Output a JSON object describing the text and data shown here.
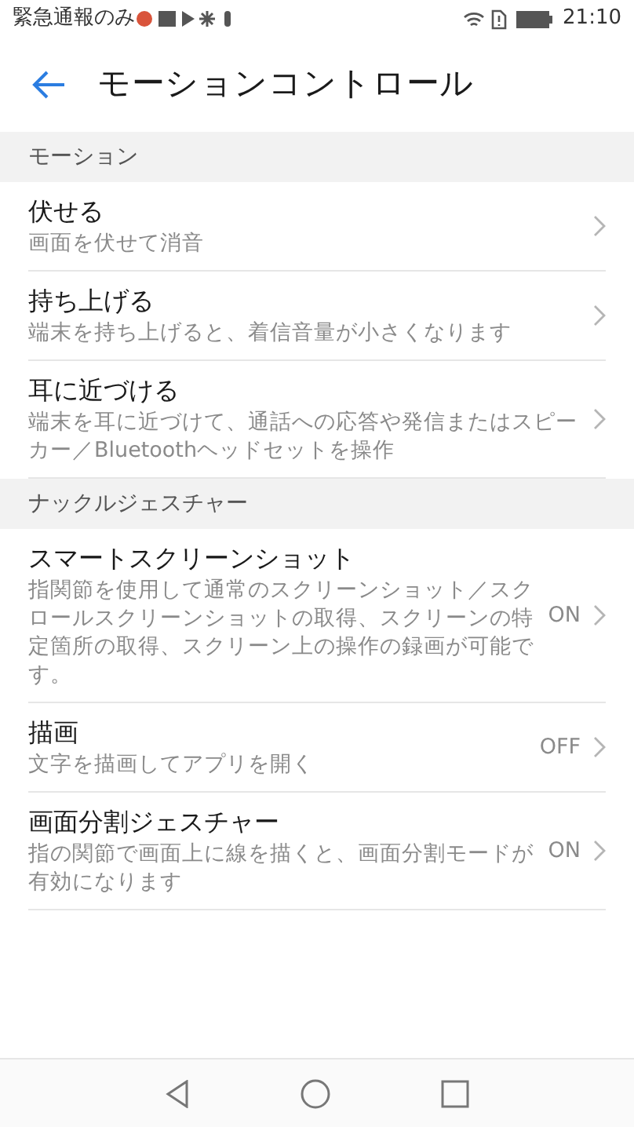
{
  "status_bar": {
    "carrier": "緊急通報のみ",
    "time": "21:10"
  },
  "header": {
    "title": "モーションコントロール"
  },
  "sections": [
    {
      "title": "モーション",
      "items": [
        {
          "title": "伏せる",
          "description": "画面を伏せて消音"
        },
        {
          "title": "持ち上げる",
          "description": "端末を持ち上げると、着信音量が小さくなります"
        },
        {
          "title": "耳に近づける",
          "description": "端末を耳に近づけて、通話への応答や発信またはスピーカー／Bluetoothヘッドセットを操作"
        }
      ]
    },
    {
      "title": "ナックルジェスチャー",
      "items": [
        {
          "title": "スマートスクリーンショット",
          "description": "指関節を使用して通常のスクリーンショット／スクロールスクリーンショットの取得、スクリーンの特定箇所の取得、スクリーン上の操作の録画が可能です。",
          "value": "ON"
        },
        {
          "title": "描画",
          "description": "文字を描画してアプリを開く",
          "value": "OFF"
        },
        {
          "title": "画面分割ジェスチャー",
          "description": "指の関節で画面上に線を描くと、画面分割モードが有効になります",
          "value": "ON"
        }
      ]
    }
  ]
}
